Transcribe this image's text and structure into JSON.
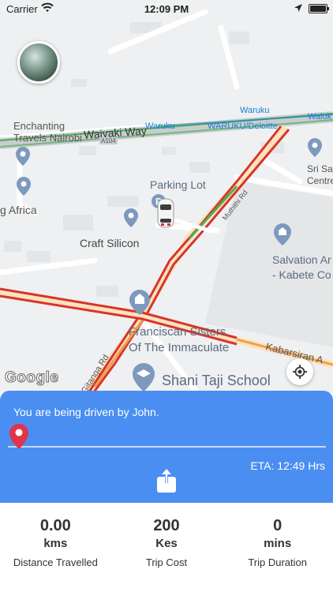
{
  "status_bar": {
    "carrier": "Carrier",
    "time": "12:09 PM"
  },
  "map": {
    "labels": {
      "enchanting": "Enchanting",
      "travels": "Travels Nairobi",
      "waiyaki": "Waiyaki Way",
      "waruku1": "Waruku",
      "waruku2": "Waruku",
      "waruku_deloitte": "WARUKU/Deloitte",
      "waluk": "Waluk",
      "sri_sat": "Sri Sat",
      "centre": "Centre",
      "parking": "Parking Lot",
      "africa": "g Africa",
      "craft": "Craft Silicon",
      "salvation": "Salvation Ar",
      "kabete": "- Kabete Co",
      "franciscan": "Franciscan Sisters",
      "immaculate": "Of The Immaculate",
      "kabarsiran": "Kabarsiran A",
      "gitanga": "Gitanga Rd",
      "shani": "Shani Taji School",
      "a104": "A104",
      "muthithi": "Muthithi Rd",
      "google": "Google"
    }
  },
  "trip_panel": {
    "driver_text": "You are being driven by John.",
    "eta_text": "ETA: 12:49 Hrs"
  },
  "stats": [
    {
      "value": "0.00",
      "unit": "kms",
      "label": "Distance Travelled"
    },
    {
      "value": "200",
      "unit": "Kes",
      "label": "Trip Cost"
    },
    {
      "value": "0",
      "unit": "mins",
      "label": "Trip Duration"
    }
  ],
  "colors": {
    "panel": "#4a8ef2",
    "route_red": "#d9342b",
    "route_orange": "#f0a04b",
    "route_green": "#4caf50",
    "transit": "#1a7fcf"
  }
}
